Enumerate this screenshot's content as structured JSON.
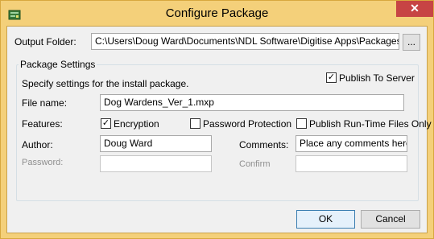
{
  "window": {
    "title": "Configure Package",
    "close_glyph": "✕",
    "app_icon": "package-settings-icon"
  },
  "output": {
    "label": "Output Folder:",
    "value": "C:\\Users\\Doug Ward\\Documents\\NDL Software\\Digitise Apps\\Packages\\Export",
    "browse_label": "..."
  },
  "settings": {
    "legend": "Package Settings",
    "description": "Specify settings for the install package.",
    "publish_to_server": {
      "label": "Publish To Server",
      "checked": true
    },
    "file_name": {
      "label": "File name:",
      "value": "Dog Wardens_Ver_1.mxp"
    },
    "features": {
      "label": "Features:",
      "encryption": {
        "label": "Encryption",
        "checked": true
      },
      "password_protection": {
        "label": "Password Protection",
        "checked": false
      },
      "publish_runtime_only": {
        "label": "Publish Run-Time Files Only",
        "checked": false
      }
    },
    "author": {
      "label": "Author:",
      "value": "Doug Ward"
    },
    "comments": {
      "label": "Comments:",
      "value": "Place any comments here..."
    },
    "password": {
      "label": "Password:",
      "value": ""
    },
    "confirm": {
      "label": "Confirm",
      "value": ""
    }
  },
  "buttons": {
    "ok": "OK",
    "cancel": "Cancel"
  },
  "check_glyph": "✓",
  "colors": {
    "frame": "#f4d07a",
    "close": "#c74444",
    "default_button_border": "#3c7fb1"
  }
}
